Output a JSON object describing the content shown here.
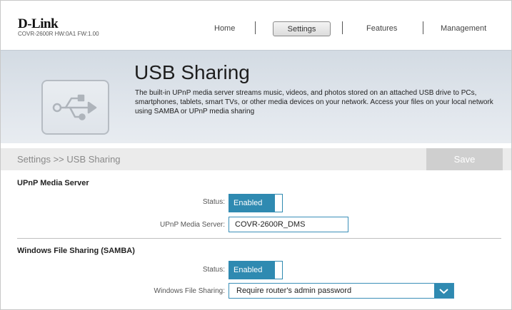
{
  "brand": {
    "name": "D-Link",
    "model": "COVR-2600R HW:0A1 FW:1.00"
  },
  "nav": {
    "home": "Home",
    "settings": "Settings",
    "features": "Features",
    "management": "Management"
  },
  "banner": {
    "title": "USB Sharing",
    "description": "The built-in UPnP media server streams music, videos, and photos stored on an attached USB drive to PCs, smartphones, tablets, smart TVs, or other media devices on your network. Access your files on your local network using SAMBA or UPnP media sharing",
    "icon": "usb-icon"
  },
  "breadcrumb": "Settings >> USB Sharing",
  "save_label": "Save",
  "upnp": {
    "title": "UPnP Media Server",
    "status_label": "Status:",
    "status_value": "Enabled",
    "server_label": "UPnP Media Server:",
    "server_value": "COVR-2600R_DMS"
  },
  "samba": {
    "title": "Windows File Sharing (SAMBA)",
    "status_label": "Status:",
    "status_value": "Enabled",
    "sharing_label": "Windows File Sharing:",
    "sharing_value": "Require router's admin password"
  },
  "colors": {
    "accent": "#2f8ab1",
    "save_disabled": "#cfcfcf"
  }
}
